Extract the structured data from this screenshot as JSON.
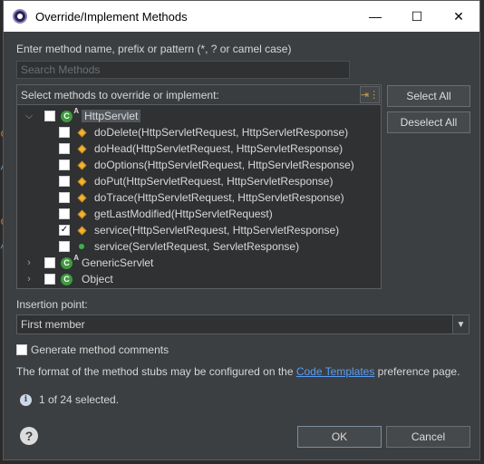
{
  "window": {
    "title": "Override/Implement Methods",
    "controls": [
      "—",
      "☐",
      "✕"
    ]
  },
  "search": {
    "label": "Enter method name, prefix or pattern (*, ? or camel case)",
    "placeholder": "Search Methods",
    "value": ""
  },
  "tree": {
    "header": "Select methods to override or implement:",
    "filter_icon": "hierarchy-filter-icon",
    "classes": [
      {
        "name": "HttpServlet",
        "expanded": true,
        "checked": false,
        "abstract": true,
        "methods": [
          {
            "label": "doDelete(HttpServletRequest, HttpServletResponse)",
            "checked": false,
            "visibility": "protected"
          },
          {
            "label": "doHead(HttpServletRequest, HttpServletResponse)",
            "checked": false,
            "visibility": "protected"
          },
          {
            "label": "doOptions(HttpServletRequest, HttpServletResponse)",
            "checked": false,
            "visibility": "protected"
          },
          {
            "label": "doPut(HttpServletRequest, HttpServletResponse)",
            "checked": false,
            "visibility": "protected"
          },
          {
            "label": "doTrace(HttpServletRequest, HttpServletResponse)",
            "checked": false,
            "visibility": "protected"
          },
          {
            "label": "getLastModified(HttpServletRequest)",
            "checked": false,
            "visibility": "protected"
          },
          {
            "label": "service(HttpServletRequest, HttpServletResponse)",
            "checked": true,
            "visibility": "protected"
          },
          {
            "label": "service(ServletRequest, ServletResponse)",
            "checked": false,
            "visibility": "public"
          }
        ]
      },
      {
        "name": "GenericServlet",
        "expanded": false,
        "checked": false,
        "abstract": true
      },
      {
        "name": "Object",
        "expanded": false,
        "checked": false,
        "abstract": false
      }
    ]
  },
  "buttons": {
    "select_all": "Select All",
    "deselect_all": "Deselect All",
    "ok": "OK",
    "cancel": "Cancel"
  },
  "insertion": {
    "label": "Insertion point:",
    "value": "First member"
  },
  "generate_comments": {
    "label": "Generate method comments",
    "checked": false
  },
  "footer": {
    "text_before": "The format of the method stubs may be configured on the ",
    "link": "Code Templates",
    "text_after": " preference page.",
    "status": "1 of 24 selected."
  },
  "colors": {
    "dialog_bg": "#3c3f41",
    "link": "#589df6",
    "class_icon": "#3f9a3f",
    "protected_method": "#f2b233",
    "public_method": "#3fae4f"
  }
}
